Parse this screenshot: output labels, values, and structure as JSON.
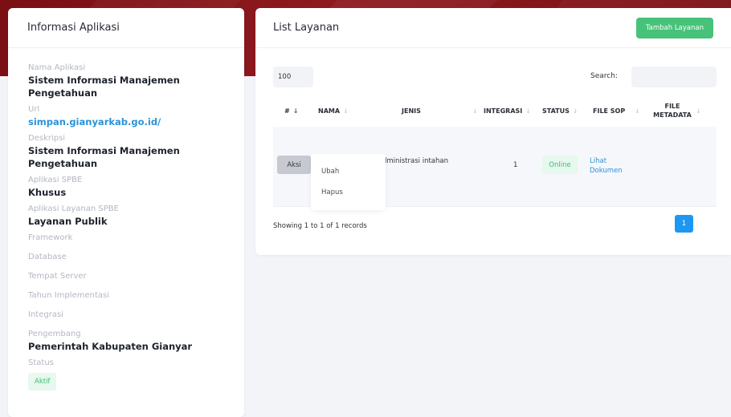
{
  "info_panel": {
    "title": "Informasi Aplikasi",
    "fields": [
      {
        "label": "Nama Aplikasi",
        "value": "Sistem Informasi Manajemen Pengetahuan"
      },
      {
        "label": "Url",
        "value": "simpan.gianyarkab.go.id/"
      },
      {
        "label": "Deskripsi",
        "value": "Sistem Informasi Manajemen Pengetahuan"
      },
      {
        "label": "Aplikasi SPBE",
        "value": "Khusus"
      },
      {
        "label": "Aplikasi Layanan SPBE",
        "value": "Layanan Publik"
      },
      {
        "label": "Framework",
        "value": ""
      },
      {
        "label": "Database",
        "value": ""
      },
      {
        "label": "Tempat Server",
        "value": ""
      },
      {
        "label": "Tahun Implementasi",
        "value": ""
      },
      {
        "label": "Integrasi",
        "value": ""
      },
      {
        "label": "Pengembang",
        "value": "Pemerintah Kabupaten Gianyar"
      },
      {
        "label": "Status",
        "value": "Aktif"
      }
    ]
  },
  "list_panel": {
    "title": "List Layanan",
    "add_button": "Tambah Layanan",
    "page_length": "100",
    "search_label": "Search:",
    "search_placeholder": "",
    "columns": [
      "#",
      "NAMA",
      "JENIS",
      "INTEGRASI",
      "STATUS",
      "FILE SOP",
      "FILE METADATA"
    ],
    "rows": [
      {
        "action": "Aksi",
        "nama": "",
        "jenis": "an Administrasi intahan",
        "integrasi": "1",
        "status": "Online",
        "file_sop": "Lihat Dokumen",
        "file_metadata": ""
      }
    ],
    "action_menu": [
      "Ubah",
      "Hapus"
    ],
    "info_text": "Showing 1 to 1 of 1 records",
    "current_page": "1"
  },
  "colors": {
    "banner": "#8e1a1e",
    "accent_green": "#47c27a",
    "link_blue": "#2a93d8",
    "pagination_blue": "#1d98f0"
  },
  "icons": [
    "sort-icon"
  ]
}
